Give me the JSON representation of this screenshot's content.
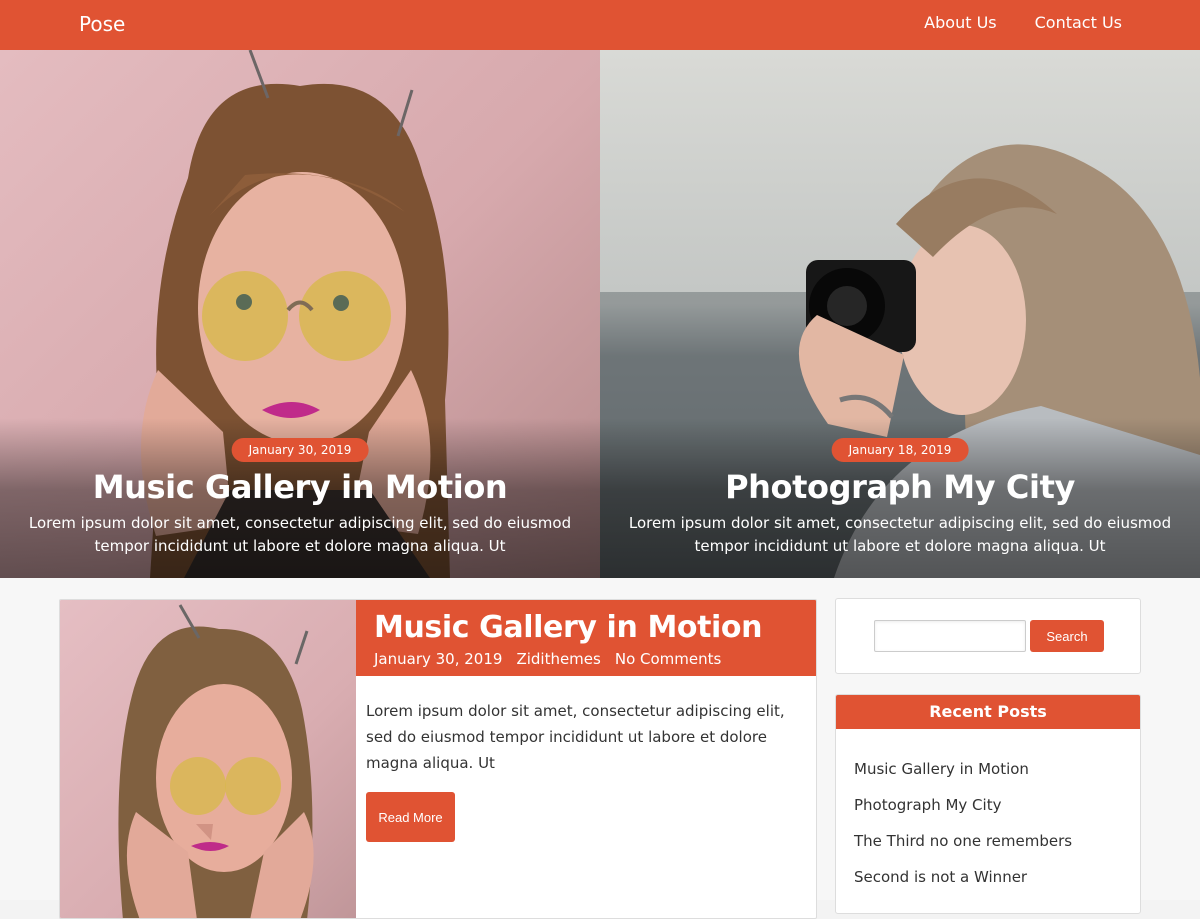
{
  "site": {
    "brand": "Pose"
  },
  "nav": {
    "items": [
      "About Us",
      "Contact Us"
    ]
  },
  "hero": [
    {
      "date": "January 30, 2019",
      "title": "Music Gallery in Motion",
      "excerpt": "Lorem ipsum dolor sit amet, consectetur adipiscing elit, sed do eiusmod tempor incididunt ut labore et dolore magna aliqua. Ut"
    },
    {
      "date": "January 18, 2019",
      "title": "Photograph My City",
      "excerpt": "Lorem ipsum dolor sit amet, consectetur adipiscing elit, sed do eiusmod tempor incididunt ut labore et dolore magna aliqua. Ut"
    }
  ],
  "post": {
    "title": "Music Gallery in Motion",
    "date": "January 30, 2019",
    "author": "Zidithemes",
    "comments": "No Comments",
    "excerpt": "Lorem ipsum dolor sit amet, consectetur adipiscing elit, sed do eiusmod tempor incididunt ut labore et dolore magna aliqua. Ut",
    "button": "Read More"
  },
  "sidebar": {
    "search_button": "Search",
    "recent_title": "Recent Posts",
    "recent_posts": [
      "Music Gallery in Motion",
      "Photograph My City",
      "The Third no one remembers",
      "Second is not a Winner"
    ]
  },
  "colors": {
    "accent": "#e05333"
  }
}
